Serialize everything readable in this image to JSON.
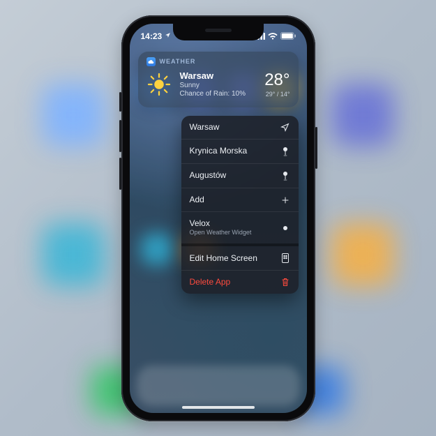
{
  "status": {
    "time": "14:23",
    "location_services": true
  },
  "widget": {
    "app_label": "WEATHER",
    "city": "Warsaw",
    "condition": "Sunny",
    "rain_label": "Chance of Rain: 10%",
    "temp": "28°",
    "range": "29° / 14°",
    "icon": "sun-icon"
  },
  "menu": {
    "items": [
      {
        "label": "Warsaw",
        "icon": "location-arrow-icon"
      },
      {
        "label": "Krynica Morska",
        "icon": "pin-icon"
      },
      {
        "label": "Augustów",
        "icon": "pin-icon"
      },
      {
        "label": "Add",
        "icon": "plus-icon"
      },
      {
        "label": "Velox",
        "sub": "Open Weather Widget",
        "icon": "dot-icon"
      }
    ],
    "edit_label": "Edit Home Screen",
    "delete_label": "Delete App"
  },
  "colors": {
    "danger": "#ff4b3e",
    "widget_bg": "rgba(55,73,95,.72)",
    "menu_bg": "rgba(28,32,40,.88)"
  }
}
